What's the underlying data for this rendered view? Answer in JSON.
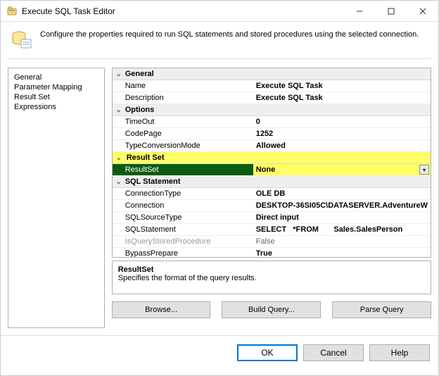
{
  "window": {
    "title": "Execute SQL Task Editor",
    "description": "Configure the properties required to run SQL statements and stored procedures using the selected connection."
  },
  "nav": {
    "items": [
      {
        "label": "General"
      },
      {
        "label": "Parameter Mapping"
      },
      {
        "label": "Result Set"
      },
      {
        "label": "Expressions"
      }
    ]
  },
  "groups": {
    "general": {
      "title": "General",
      "name_label": "Name",
      "name_value": "Execute SQL Task",
      "desc_label": "Description",
      "desc_value": "Execute SQL Task"
    },
    "options": {
      "title": "Options",
      "timeout_label": "TimeOut",
      "timeout_value": "0",
      "codepage_label": "CodePage",
      "codepage_value": "1252",
      "tcm_label": "TypeConversionMode",
      "tcm_value": "Allowed"
    },
    "resultset": {
      "title": "Result Set",
      "rs_label": "ResultSet",
      "rs_value": "None"
    },
    "sql": {
      "title": "SQL Statement",
      "ct_label": "ConnectionType",
      "ct_value": "OLE DB",
      "conn_label": "Connection",
      "conn_value": "DESKTOP-36SI05C\\DATASERVER.AdventureW",
      "src_label": "SQLSourceType",
      "src_value": "Direct input",
      "stmt_label": "SQLStatement",
      "stmt_value": "SELECT   *FROM       Sales.SalesPerson",
      "isp_label": "IsQueryStoredProcedure",
      "isp_value": "False",
      "bp_label": "BypassPrepare",
      "bp_value": "True"
    }
  },
  "help": {
    "title": "ResultSet",
    "text": "Specifies the format of the query results."
  },
  "actions": {
    "browse": "Browse...",
    "build": "Build Query...",
    "parse": "Parse Query"
  },
  "footer": {
    "ok": "OK",
    "cancel": "Cancel",
    "help": "Help"
  }
}
